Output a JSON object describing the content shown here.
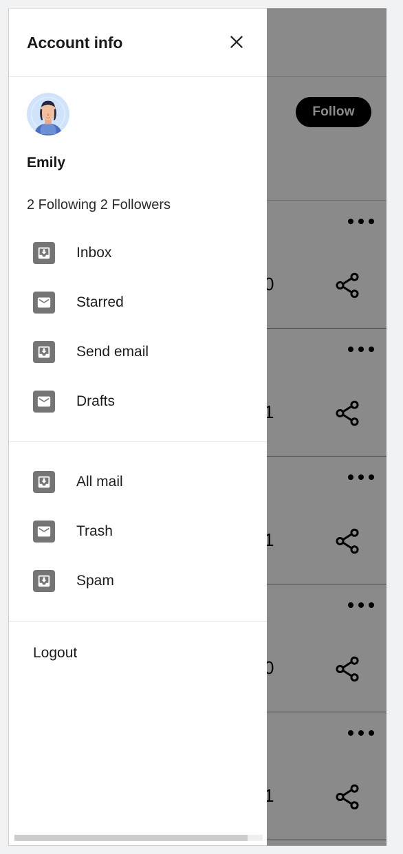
{
  "drawer": {
    "title": "Account info",
    "close_icon": "close-icon",
    "profile": {
      "avatar_icon": "user-avatar-illustration",
      "name": "Emily",
      "stats": "2 Following 2 Followers"
    },
    "nav_groups": [
      {
        "items": [
          {
            "label": "Inbox",
            "icon": "move-to-inbox-icon"
          },
          {
            "label": "Starred",
            "icon": "envelope-icon"
          },
          {
            "label": "Send email",
            "icon": "move-to-inbox-icon"
          },
          {
            "label": "Drafts",
            "icon": "envelope-icon"
          }
        ]
      },
      {
        "items": [
          {
            "label": "All mail",
            "icon": "move-to-inbox-icon"
          },
          {
            "label": "Trash",
            "icon": "envelope-icon"
          },
          {
            "label": "Spam",
            "icon": "move-to-inbox-icon"
          }
        ]
      }
    ],
    "logout_label": "Logout"
  },
  "background": {
    "follow_label": "Follow",
    "posts": [
      {
        "count": "0",
        "more_icon": "more-horizontal-icon",
        "share_icon": "share-icon"
      },
      {
        "count": "1",
        "more_icon": "more-horizontal-icon",
        "share_icon": "share-icon"
      },
      {
        "count": "1",
        "more_icon": "more-horizontal-icon",
        "share_icon": "share-icon"
      },
      {
        "count": "0",
        "more_icon": "more-horizontal-icon",
        "share_icon": "share-icon"
      },
      {
        "count": "1",
        "more_icon": "more-horizontal-icon",
        "share_icon": "share-icon"
      }
    ]
  },
  "colors": {
    "accent_dark": "#000000",
    "icon_gray": "#757575",
    "page_bg": "#f1f2f3",
    "avatar_bg": "#cfe4fb"
  }
}
